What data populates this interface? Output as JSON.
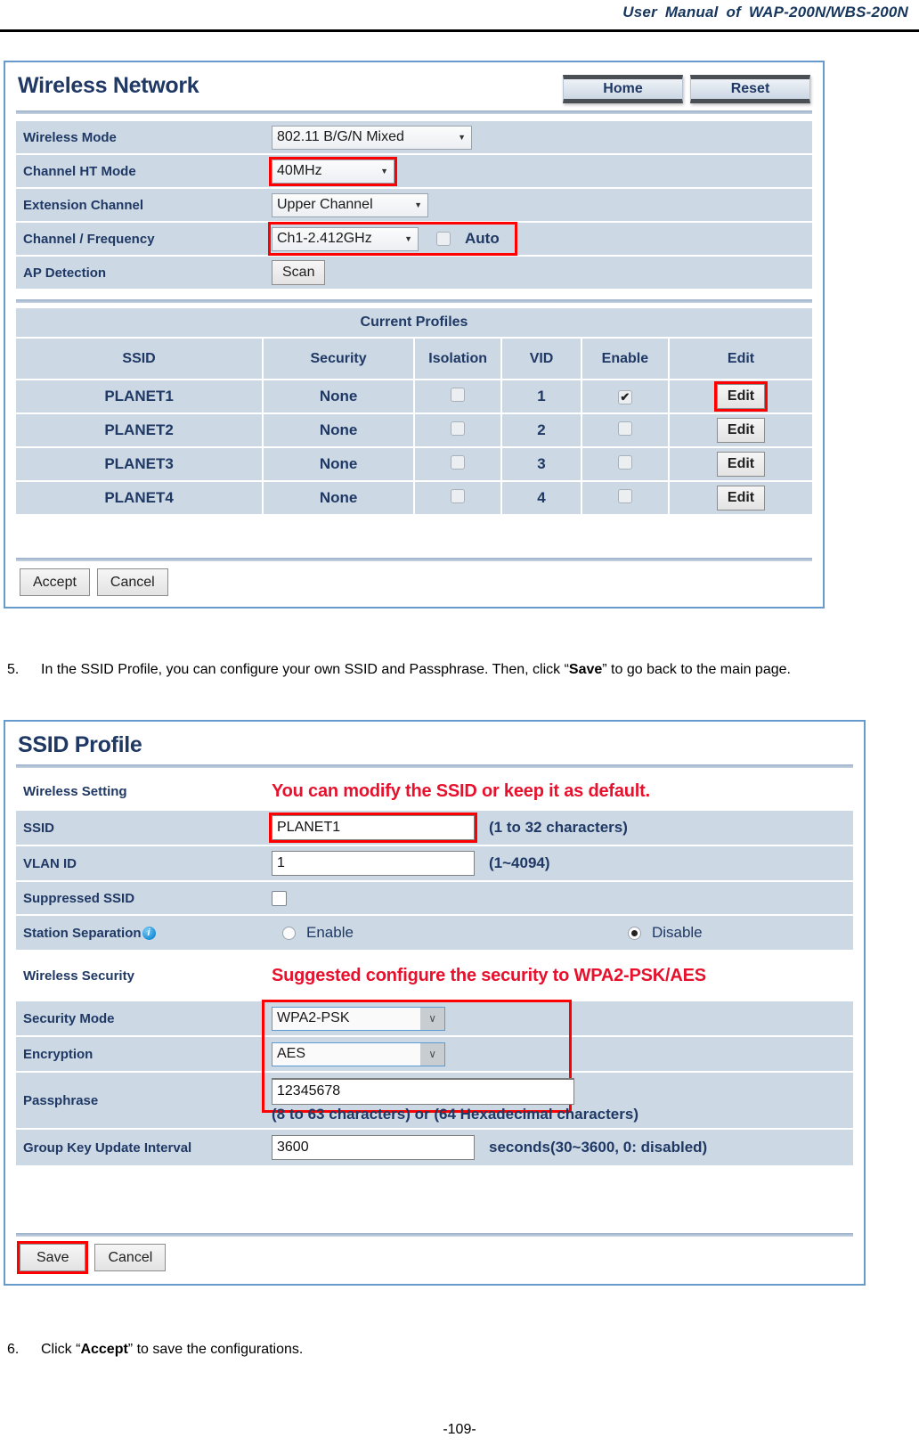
{
  "header": {
    "title": "User Manual of WAP-200N/WBS-200N"
  },
  "wireless_network": {
    "title": "Wireless Network",
    "nav": {
      "home": "Home",
      "reset": "Reset"
    },
    "fields": [
      {
        "label": "Wireless Mode",
        "value": "802.11 B/G/N Mixed"
      },
      {
        "label": "Channel HT Mode",
        "value": "40MHz"
      },
      {
        "label": "Extension Channel",
        "value": "Upper Channel"
      },
      {
        "label": "Channel / Frequency",
        "value": "Ch1-2.412GHz",
        "auto_label": "Auto"
      },
      {
        "label": "AP Detection",
        "value": "Scan"
      }
    ],
    "profiles": {
      "caption": "Current Profiles",
      "columns": [
        "SSID",
        "Security",
        "Isolation",
        "VID",
        "Enable",
        "Edit"
      ],
      "rows": [
        {
          "ssid": "PLANET1",
          "security": "None",
          "isolation": false,
          "vid": "1",
          "enable": true,
          "edit": "Edit"
        },
        {
          "ssid": "PLANET2",
          "security": "None",
          "isolation": false,
          "vid": "2",
          "enable": false,
          "edit": "Edit"
        },
        {
          "ssid": "PLANET3",
          "security": "None",
          "isolation": false,
          "vid": "3",
          "enable": false,
          "edit": "Edit"
        },
        {
          "ssid": "PLANET4",
          "security": "None",
          "isolation": false,
          "vid": "4",
          "enable": false,
          "edit": "Edit"
        }
      ]
    },
    "buttons": {
      "accept": "Accept",
      "cancel": "Cancel"
    }
  },
  "step5": {
    "number": "5.",
    "text_before": "In the SSID Profile, you can configure your own SSID and Passphrase. Then, click “",
    "bold": "Save",
    "text_after": "” to go back to the main page."
  },
  "ssid_profile": {
    "title": "SSID Profile",
    "section_wireless_setting": {
      "label": "Wireless Setting",
      "annotation": "You can modify the SSID or keep it as default."
    },
    "ssid": {
      "label": "SSID",
      "value": "PLANET1",
      "hint": "(1 to 32 characters)"
    },
    "vlan_id": {
      "label": "VLAN ID",
      "value": "1",
      "hint": "(1~4094)"
    },
    "suppressed_ssid": {
      "label": "Suppressed SSID",
      "checked": false
    },
    "station_separation": {
      "label": "Station Separation",
      "info_icon": "info-icon",
      "enable_label": "Enable",
      "disable_label": "Disable",
      "selected": "Disable"
    },
    "section_wireless_security": {
      "label": "Wireless Security",
      "annotation": "Suggested configure the security to WPA2-PSK/AES"
    },
    "security_mode": {
      "label": "Security Mode",
      "value": "WPA2-PSK"
    },
    "encryption": {
      "label": "Encryption",
      "value": "AES"
    },
    "passphrase": {
      "label": "Passphrase",
      "value": "12345678",
      "hint": "(8 to 63 characters) or (64 Hexadecimal characters)"
    },
    "group_key": {
      "label": "Group Key Update Interval",
      "value": "3600",
      "hint": "seconds(30~3600, 0: disabled)"
    },
    "buttons": {
      "save": "Save",
      "cancel": "Cancel"
    }
  },
  "step6": {
    "number": "6.",
    "text_before": "Click “",
    "bold": "Accept",
    "text_after": "” to save the configurations."
  },
  "page_number": "-109-",
  "colors": {
    "header_navy": "#17365d",
    "panel_border_blue": "#6699cc",
    "row_blue": "#ccd9e5",
    "label_navy": "#1f3864",
    "highlight_red": "#ff0000",
    "annotation_red": "#e8112d"
  }
}
